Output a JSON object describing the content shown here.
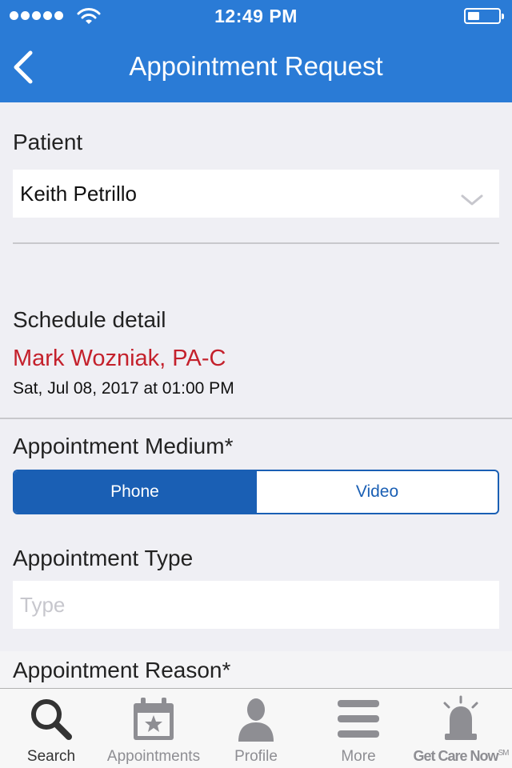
{
  "status": {
    "time": "12:49 PM"
  },
  "nav": {
    "title": "Appointment Request"
  },
  "form": {
    "patient_label": "Patient",
    "patient_value": "Keith Petrillo",
    "schedule_label": "Schedule detail",
    "provider": "Mark Wozniak, PA-C",
    "datetime": "Sat, Jul 08, 2017 at 01:00 PM",
    "medium_label": "Appointment Medium*",
    "medium_options": [
      "Phone",
      "Video"
    ],
    "medium_selected": "Phone",
    "type_label": "Appointment Type",
    "type_placeholder": "Type",
    "reason_label": "Appointment Reason*"
  },
  "tabs": [
    {
      "label": "Search",
      "icon": "search-icon",
      "selected": true
    },
    {
      "label": "Appointments",
      "icon": "calendar-star-icon",
      "selected": false
    },
    {
      "label": "Profile",
      "icon": "person-icon",
      "selected": false
    },
    {
      "label": "More",
      "icon": "menu-icon",
      "selected": false
    },
    {
      "label": "Get Care Now",
      "label_suffix": "SM",
      "icon": "alarm-light-icon",
      "selected": false
    }
  ],
  "colors": {
    "brand_blue": "#2a7bd6",
    "segment_blue": "#1a5fb4",
    "provider_red": "#c4212c"
  }
}
